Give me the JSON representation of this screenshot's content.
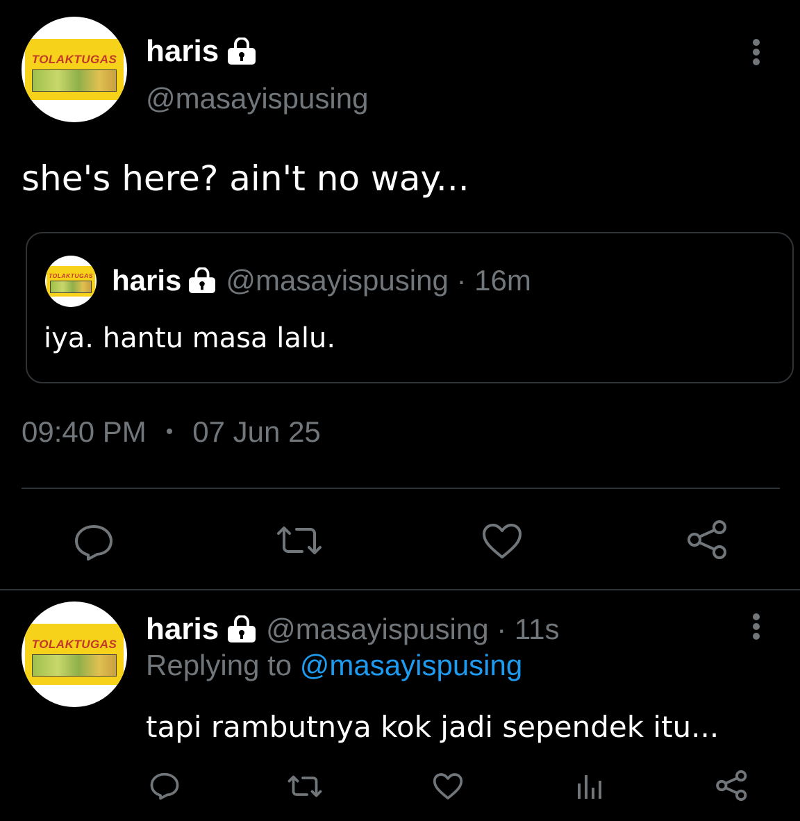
{
  "main_tweet": {
    "avatar_text": "TOLAKTUGAS",
    "name": "haris",
    "handle": "@masayispusing",
    "text": "she's here? ain't no way...",
    "time": "09:40 PM",
    "dot": "•",
    "date": "07 Jun 25",
    "icons": [
      "more-vertical-icon",
      "lock-icon",
      "reply-icon",
      "retweet-icon",
      "like-icon",
      "share-icon"
    ]
  },
  "quoted_tweet": {
    "avatar_text": "TOLAKTUGAS",
    "name": "haris",
    "meta": "@masayispusing · 16m",
    "text": "iya. hantu masa lalu."
  },
  "reply_tweet": {
    "avatar_text": "TOLAKTUGAS",
    "name": "haris",
    "meta": "@masayispusing · 11s",
    "replying_prefix": "Replying to",
    "replying_handle": "@masayispusing",
    "text": "tapi rambutnya kok jadi sependek itu...",
    "icons": [
      "reply-icon",
      "retweet-icon",
      "like-icon",
      "analytics-icon",
      "share-icon"
    ]
  },
  "colors": {
    "background": "#000000",
    "text": "#e7e9ea",
    "muted": "#71767b",
    "link": "#1d9bf0",
    "border": "#2f3336"
  }
}
